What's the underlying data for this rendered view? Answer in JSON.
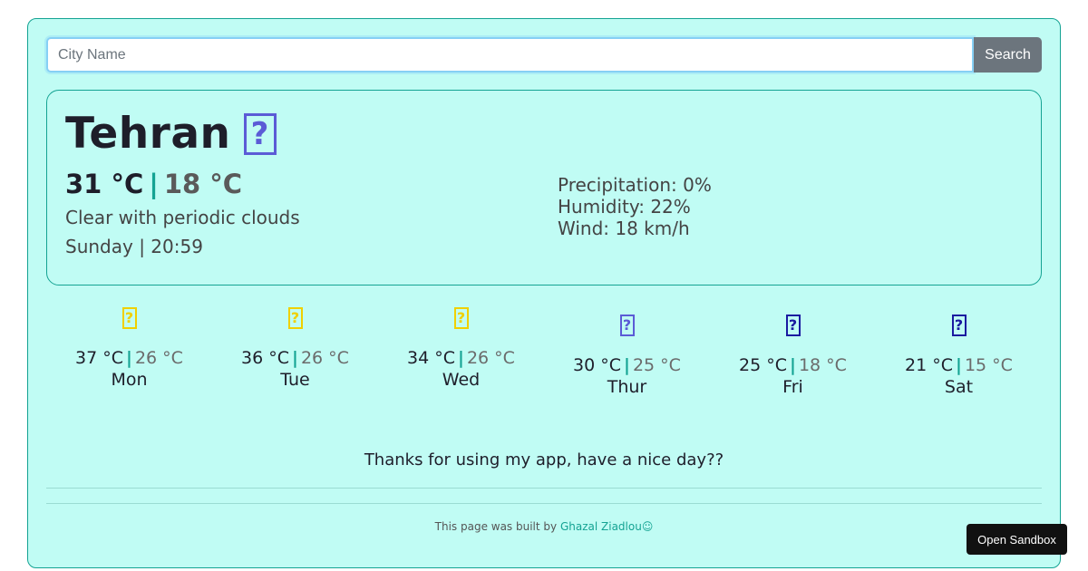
{
  "search": {
    "placeholder": "City Name",
    "value": "",
    "button_label": "Search"
  },
  "current": {
    "city": "Tehran",
    "icon": "cloud-sun-icon",
    "icon_glyph": "?",
    "icon_color": "#5b5bd6",
    "temp_max": "31 °C",
    "separator": "|",
    "temp_min": "18 °C",
    "description": "Clear with periodic clouds",
    "datetime": "Sunday | 20:59",
    "precipitation": "Precipitation: 0%",
    "humidity": "Humidity: 22%",
    "wind": "Wind: 18 km/h"
  },
  "forecast": [
    {
      "day": "Mon",
      "max": "37 °C",
      "min": "26 °C",
      "icon": "sun-icon",
      "glyph": "?",
      "color": "#f0d000"
    },
    {
      "day": "Tue",
      "max": "36 °C",
      "min": "26 °C",
      "icon": "sun-icon",
      "glyph": "?",
      "color": "#f0d000"
    },
    {
      "day": "Wed",
      "max": "34 °C",
      "min": "26 °C",
      "icon": "sun-icon",
      "glyph": "?",
      "color": "#f0d000"
    },
    {
      "day": "Thur",
      "max": "30 °C",
      "min": "25 °C",
      "icon": "cloud-icon",
      "glyph": "?",
      "color": "#5b5bd6"
    },
    {
      "day": "Fri",
      "max": "25 °C",
      "min": "18 °C",
      "icon": "rain-icon",
      "glyph": "?",
      "color": "#1a1aa0"
    },
    {
      "day": "Sat",
      "max": "21 °C",
      "min": "15 °C",
      "icon": "rain-icon",
      "glyph": "?",
      "color": "#1a1aa0"
    }
  ],
  "thanks": "Thanks for using my app, have a nice day??",
  "footer": {
    "prefix": "This page was built by ",
    "author": "Ghazal Ziadlou",
    "suffix": "☺"
  },
  "sandbox_label": "Open Sandbox"
}
